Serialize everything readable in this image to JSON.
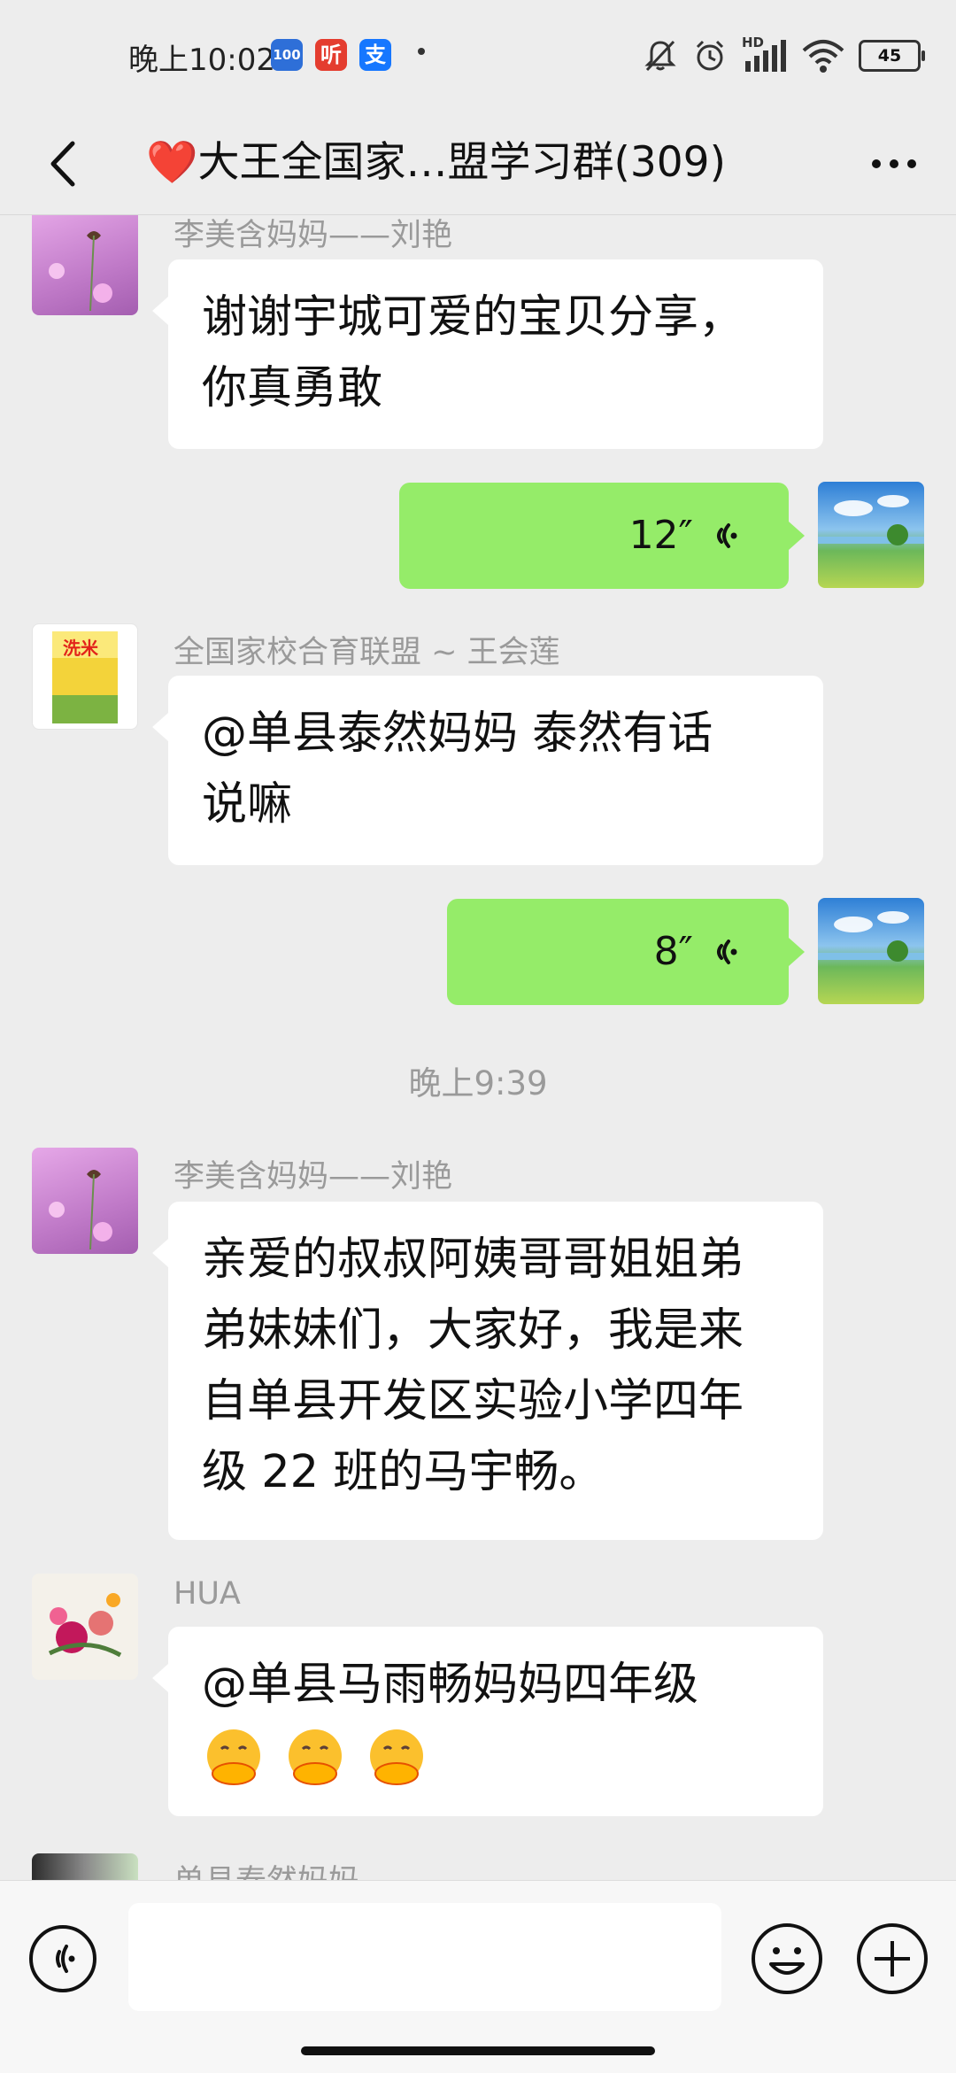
{
  "status_bar": {
    "time": "晚上10:02",
    "app_icons": [
      {
        "name": "app-100-icon",
        "text": "100",
        "color": "#2e6fd8"
      },
      {
        "name": "app-ting-icon",
        "text": "听",
        "color": "#e43d2f"
      },
      {
        "name": "alipay-icon",
        "text": "支",
        "color": "#1677ff"
      }
    ],
    "battery": "45",
    "network_label": "HD"
  },
  "header": {
    "title_heart": "❤️",
    "title": "大王全国家…盟学习群(309)"
  },
  "messages": [
    {
      "type": "text",
      "side": "in",
      "sender": "李美含妈妈——刘艳",
      "lines": [
        "谢谢宇城可爱的宝贝分享，",
        "你真勇敢"
      ]
    },
    {
      "type": "voice",
      "side": "out",
      "duration": "12″"
    },
    {
      "type": "text",
      "side": "in",
      "sender": "全国家校合育联盟 ~ 王会莲",
      "lines": [
        "@单县泰然妈妈  泰然有话",
        "说嘛"
      ]
    },
    {
      "type": "voice",
      "side": "out",
      "duration": "8″"
    },
    {
      "type": "time",
      "text": "晚上9:39"
    },
    {
      "type": "text",
      "side": "in",
      "sender": "李美含妈妈——刘艳",
      "lines": [
        "亲爱的叔叔阿姨哥哥姐姐弟",
        "弟妹妹们，大家好，我是来",
        "自单县开发区实验小学四年",
        "级 22 班的马宇畅。"
      ]
    },
    {
      "type": "text",
      "side": "in",
      "sender": "HUA",
      "lines": [
        "@单县马雨畅妈妈四年级"
      ],
      "emoji": "face-with-hand-over-mouth-emoji ×3"
    },
    {
      "type": "partial",
      "side": "in",
      "sender": "单县泰然妈妈"
    }
  ],
  "input_bar": {
    "placeholder": ""
  },
  "colors": {
    "chat_bg": "#ededed",
    "outgoing_bubble": "#95ec69",
    "incoming_bubble": "#ffffff",
    "heart": "#f0465f"
  }
}
